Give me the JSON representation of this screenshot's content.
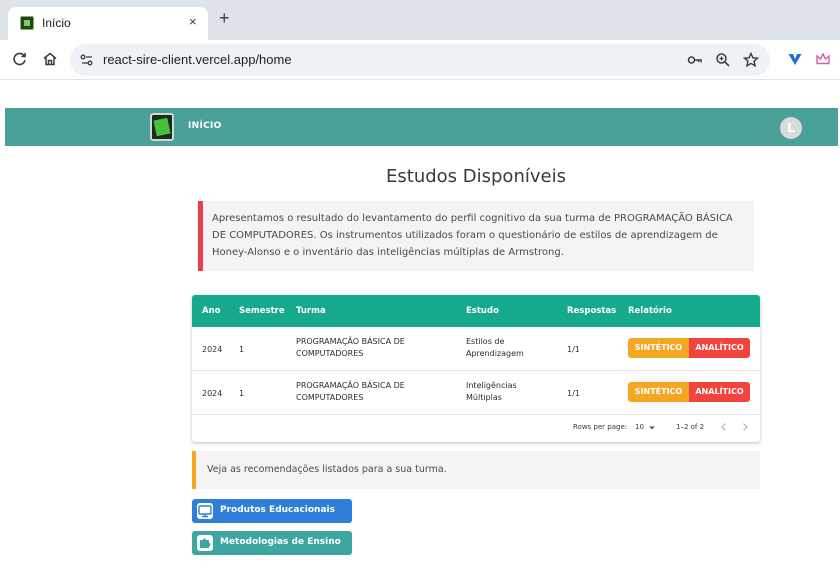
{
  "browser": {
    "tab_title": "Início",
    "tab_close": "×",
    "new_tab": "+",
    "url": "react-sire-client.vercel.app/home"
  },
  "app": {
    "nav_home": "INÍCIO",
    "avatar_initial": "L"
  },
  "page": {
    "title": "Estudos Disponíveis",
    "intro": "Apresentamos o resultado do levantamento do perfil cognitivo da sua turma de PROGRAMAÇÃO BÁSICA DE COMPUTADORES. Os instrumentos utilizados foram o questionário de estilos de aprendizagem de Honey-Alonso e o inventário das inteligências múltiplas de Armstrong."
  },
  "table": {
    "headers": [
      "Ano",
      "Semestre",
      "Turma",
      "Estudo",
      "Respostas",
      "Relatório"
    ],
    "rows": [
      {
        "ano": "2024",
        "semestre": "1",
        "turma": [
          "PROGRAMAÇÃO BÁSICA DE",
          "COMPUTADORES"
        ],
        "estudo": [
          "Estilos de",
          "Aprendizagem"
        ],
        "respostas": "1/1",
        "btn_sintetico": "SINTÉTICO",
        "btn_analitico": "ANALÍTICO"
      },
      {
        "ano": "2024",
        "semestre": "1",
        "turma": [
          "PROGRAMAÇÃO BÁSICA DE",
          "COMPUTADORES"
        ],
        "estudo": [
          "Inteligências",
          "Múltiplas"
        ],
        "respostas": "1/1",
        "btn_sintetico": "SINTÉTICO",
        "btn_analitico": "ANALÍTICO"
      }
    ],
    "pagination": {
      "rows_per_page_label": "Rows per page:",
      "rows_per_page_value": "10",
      "range": "1–2 of 2"
    }
  },
  "recommendation": {
    "text": "Veja as recomendações listados para a sua turma."
  },
  "actions": [
    {
      "label": "Produtos Educacionais",
      "color": "#2f7fd8"
    },
    {
      "label": "Metodologias de Ensino",
      "color": "#3ea6a0"
    }
  ],
  "colors": {
    "appbar": "#4aa19a",
    "table_header": "#17a98d",
    "sintetico": "#f5a623",
    "analitico": "#f2443f",
    "intro_accent": "#e8404a",
    "reco_accent": "#f5a623"
  }
}
